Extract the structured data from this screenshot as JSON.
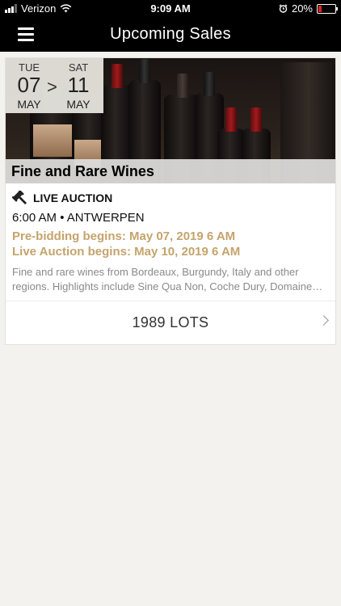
{
  "status_bar": {
    "carrier": "Verizon",
    "time": "9:09 AM",
    "battery": "20%",
    "battery_level": 0.2,
    "signal_icon": "cellular-signal-icon",
    "wifi_icon": "wifi-icon",
    "alarm_icon": "alarm-clock-icon"
  },
  "nav": {
    "title": "Upcoming Sales",
    "menu_icon": "hamburger-menu-icon"
  },
  "sale": {
    "start": {
      "weekday": "TUE",
      "day": "07",
      "month": "MAY"
    },
    "separator": ">",
    "end": {
      "weekday": "SAT",
      "day": "11",
      "month": "MAY"
    },
    "title": "Fine and Rare Wines",
    "type_icon": "gavel-icon",
    "type": "LIVE AUCTION",
    "time_location": "6:00 AM • ANTWERPEN",
    "pre_bidding": "Pre-bidding begins: May 07, 2019 6 AM",
    "live_begins": "Live Auction begins: May 10, 2019 6 AM",
    "description_line1": "Fine and rare wines from Bordeaux, Burgundy, Italy and other",
    "description_line2": "regions. Highlights include Sine Qua Non, Coche Dury, Domaine…",
    "lots": "1989 LOTS"
  },
  "colors": {
    "accent_gold": "#c4a46c",
    "bar_black": "#000000",
    "background": "#f4f2ee"
  }
}
